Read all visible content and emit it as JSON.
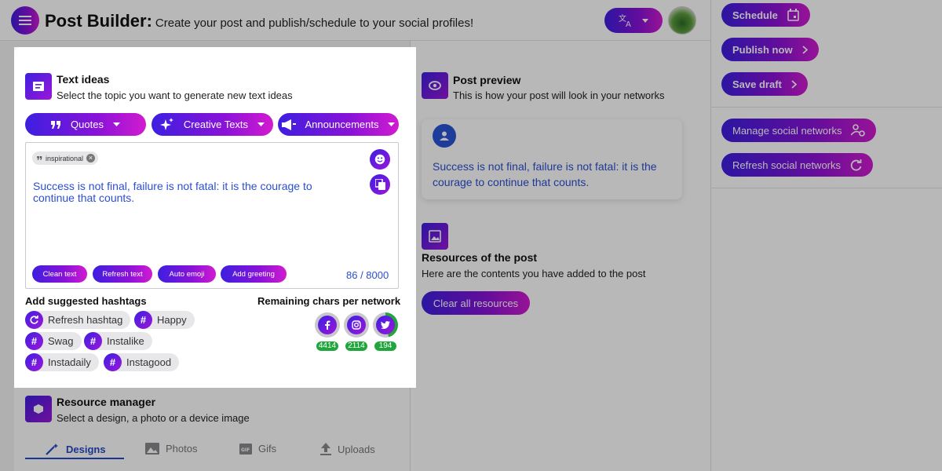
{
  "header": {
    "title": "Post Builder:",
    "subtitle": "Create your post and publish/schedule to your social profiles!"
  },
  "sidebar": {
    "schedule": "Schedule",
    "publish_now": "Publish now",
    "save_draft": "Save draft",
    "manage_networks": "Manage social networks",
    "refresh_networks": "Refresh social networks"
  },
  "text_ideas": {
    "title": "Text ideas",
    "subtitle": "Select the topic you want to generate new text ideas",
    "categories": [
      "Quotes",
      "Creative Texts",
      "Announcements"
    ],
    "tag": "inspirational",
    "text": "Success is not final, failure is not fatal: it is the courage to continue that counts.",
    "actions": [
      "Clean text",
      "Refresh text",
      "Auto emoji",
      "Add greeting"
    ],
    "counter": "86 / 8000"
  },
  "hashtags": {
    "title": "Add suggested hashtags",
    "refresh": "Refresh hashtag",
    "items": [
      "Happy",
      "Swag",
      "Instalike",
      "Instadaily",
      "Instagood"
    ]
  },
  "networks": {
    "title": "Remaining chars per network",
    "items": [
      {
        "name": "facebook",
        "count": "4414"
      },
      {
        "name": "instagram",
        "count": "2114"
      },
      {
        "name": "twitter",
        "count": "194"
      }
    ]
  },
  "post_preview": {
    "title": "Post preview",
    "subtitle": "This is how your post will look in your networks",
    "text": "Success is not final, failure is not fatal: it is the courage to continue that counts."
  },
  "resources": {
    "title": "Resources of the post",
    "subtitle": "Here are the contents you have added to the post",
    "clear": "Clear all resources"
  },
  "resource_manager": {
    "title": "Resource manager",
    "subtitle": "Select a design, a photo or a device image",
    "tabs": [
      "Designs",
      "Photos",
      "Gifs",
      "Uploads"
    ]
  },
  "colors": {
    "accent_start": "#3d1fe0",
    "accent_end": "#d21bd0",
    "link_blue": "#2b4fd0",
    "badge_green": "#21a63d"
  }
}
